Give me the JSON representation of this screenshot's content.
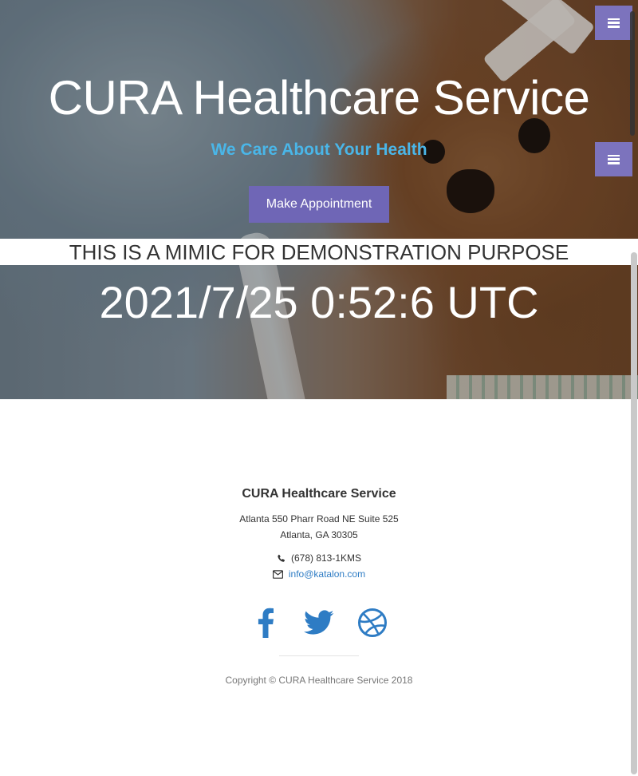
{
  "hero": {
    "title": "CURA Healthcare Service",
    "subtitle": "We Care About Your Health",
    "appointment_button": "Make Appointment",
    "demo_notice": "THIS IS A MIMIC FOR DEMONSTRATION PURPOSE",
    "clock": "2021/7/25 0:52:6 UTC"
  },
  "menu": {
    "icon": "bars-icon"
  },
  "footer": {
    "name": "CURA Healthcare Service",
    "address_line1": "Atlanta 550 Pharr Road NE Suite 525",
    "address_line2": "Atlanta, GA 30305",
    "phone": "(678) 813-1KMS",
    "email": "info@katalon.com",
    "socials": [
      "facebook-icon",
      "twitter-icon",
      "dribbble-icon"
    ],
    "copyright": "Copyright © CURA Healthcare Service 2018"
  },
  "colors": {
    "accent": "#6f66b6",
    "subtitle": "#4ab6e8",
    "link": "#2e7cc4",
    "social": "#2e7cc4"
  }
}
